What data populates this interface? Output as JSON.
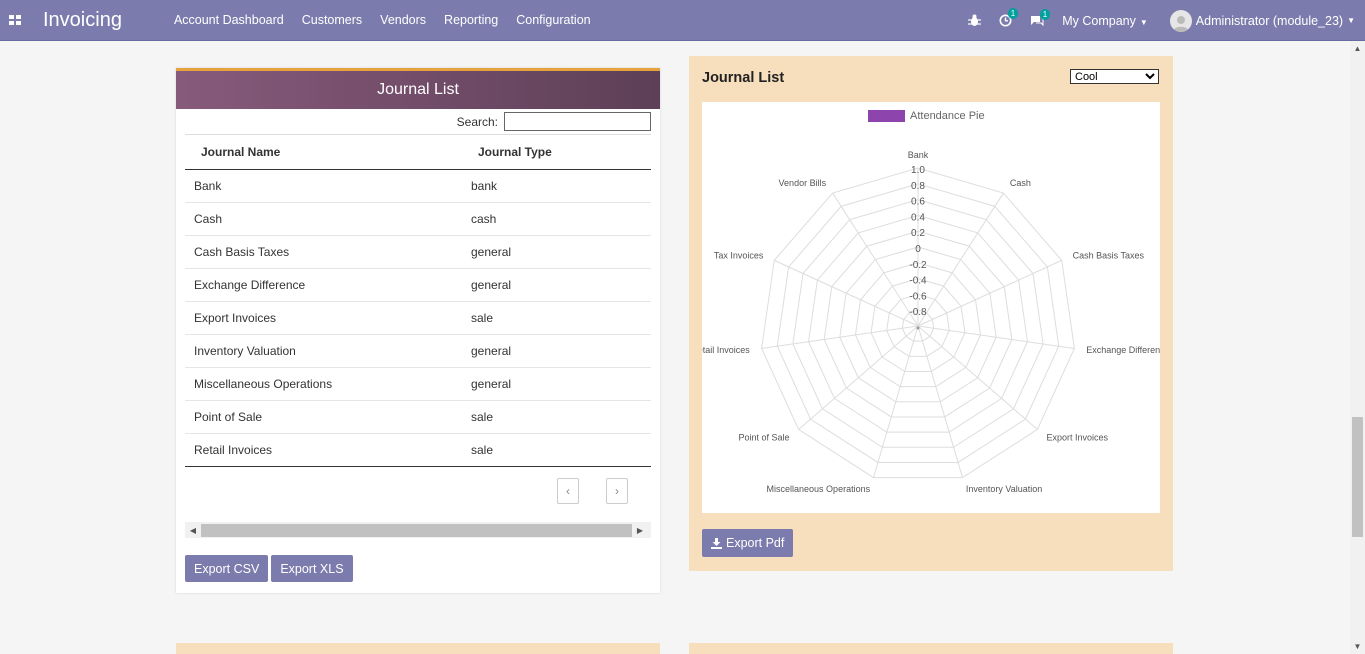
{
  "navbar": {
    "app_title": "Invoicing",
    "menu": [
      "Account Dashboard",
      "Customers",
      "Vendors",
      "Reporting",
      "Configuration"
    ],
    "activity_count": "1",
    "messages_count": "1",
    "company": "My Company",
    "user": "Administrator (module_23)",
    "bg_color": "#7c7bad"
  },
  "left_panel": {
    "title": "Journal List",
    "search_label": "Search:",
    "search_value": "",
    "columns": [
      "Journal Name",
      "Journal Type"
    ],
    "rows": [
      [
        "Bank",
        "bank"
      ],
      [
        "Cash",
        "cash"
      ],
      [
        "Cash Basis Taxes",
        "general"
      ],
      [
        "Exchange Difference",
        "general"
      ],
      [
        "Export Invoices",
        "sale"
      ],
      [
        "Inventory Valuation",
        "general"
      ],
      [
        "Miscellaneous Operations",
        "general"
      ],
      [
        "Point of Sale",
        "sale"
      ],
      [
        "Retail Invoices",
        "sale"
      ]
    ],
    "prev_label": "‹",
    "next_label": "›",
    "export_csv": "Export CSV",
    "export_xls": "Export XLS"
  },
  "right_panel": {
    "title": "Journal List",
    "theme_selected": "Cool",
    "export_pdf": "Export Pdf"
  },
  "chart_data": {
    "type": "radar",
    "legend": "Attendance Pie",
    "legend_color": "#8e44ad",
    "categories": [
      "Bank",
      "Cash",
      "Cash Basis Taxes",
      "Exchange Difference",
      "Export Invoices",
      "Inventory Valuation",
      "Miscellaneous Operations",
      "Point of Sale",
      "Retail Invoices",
      "Tax Invoices",
      "Vendor Bills"
    ],
    "ticks": [
      "1.0",
      "0.8",
      "0.6",
      "0.4",
      "0.2",
      "0",
      "-0.2",
      "-0.4",
      "-0.6",
      "-0.8"
    ],
    "series": [],
    "rlim": [
      -1,
      1
    ]
  }
}
